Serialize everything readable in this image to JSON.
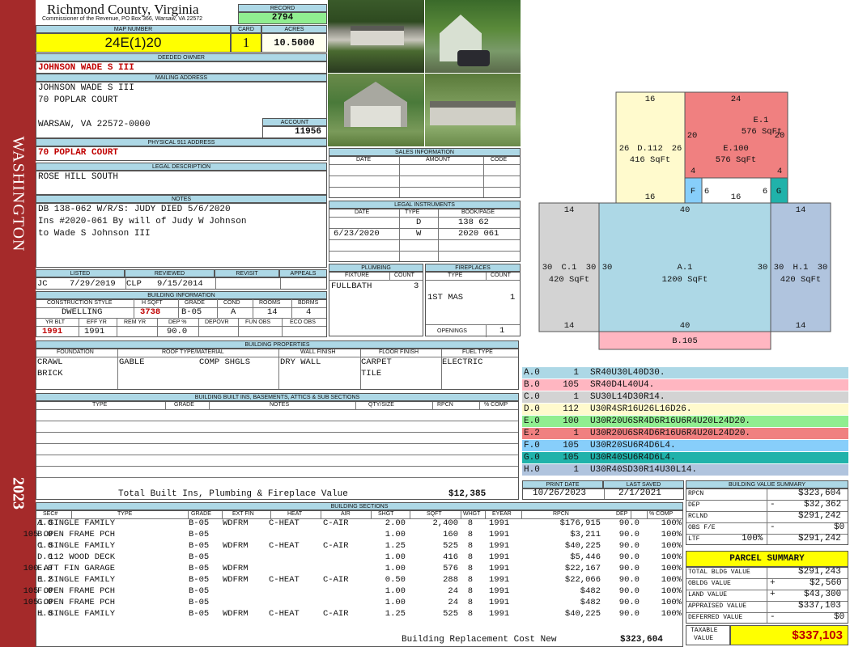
{
  "sidebar": {
    "district": "WASHINGTON",
    "year": "2023"
  },
  "header": {
    "county": "Richmond County, Virginia",
    "office": "Commissioner of the Revenue, PO Box 366, Warsaw, VA 22572"
  },
  "record": {
    "label": "RECORD",
    "value": "2794"
  },
  "map_number": {
    "label": "MAP NUMBER",
    "value": "24E(1)20"
  },
  "card": {
    "label": "CARD",
    "value": "1"
  },
  "acres": {
    "label": "ACRES",
    "value": "10.5000"
  },
  "deeded_owner": {
    "label": "DEEDED OWNER",
    "value": "JOHNSON WADE S III"
  },
  "mailing": {
    "label": "MAILING ADDRESS",
    "line1": "JOHNSON WADE S III",
    "line2": "70 POPLAR COURT",
    "line3": "WARSAW, VA 22572-0000"
  },
  "account": {
    "label": "ACCOUNT",
    "value": "11956"
  },
  "physical": {
    "label": "PHYSICAL 911 ADDRESS",
    "value": "70 POPLAR COURT"
  },
  "legal": {
    "label": "LEGAL DESCRIPTION",
    "value": "ROSE HILL SOUTH"
  },
  "notes": {
    "label": "NOTES",
    "line1": "DB 138-062 W/R/S: JUDY DIED 5/6/2020",
    "line2": "Ins #2020-061 By will of Judy W Johnson",
    "line3": "to Wade S Johnson III"
  },
  "sales": {
    "label": "SALES INFORMATION",
    "cols": [
      "DATE",
      "AMOUNT",
      "CODE"
    ]
  },
  "instruments": {
    "label": "LEGAL INSTRUMENTS",
    "cols": [
      "DATE",
      "TYPE",
      "BOOK/PAGE"
    ],
    "rows": [
      {
        "date": "",
        "type": "D",
        "bp": "138 62"
      },
      {
        "date": "6/23/2020",
        "type": "W",
        "bp": "2020 061"
      }
    ]
  },
  "listing": {
    "listed_label": "LISTED",
    "reviewed_label": "REVIEWED",
    "revisit_label": "REVISIT",
    "appeals_label": "APPEALS",
    "listed_by": "JC",
    "listed_date": "7/29/2019",
    "reviewed_by": "CLP",
    "reviewed_date": "9/15/2014"
  },
  "plumbing": {
    "label": "PLUMBING",
    "fixture_label": "FIXTURE",
    "count_label": "COUNT",
    "fixture": "FULLBATH",
    "count": "3"
  },
  "fireplaces": {
    "label": "FIREPLACES",
    "type_label": "TYPE",
    "count_label": "COUNT",
    "type": "1ST MAS",
    "count": "1",
    "openings_label": "OPENINGS",
    "openings": "1"
  },
  "building_info": {
    "label": "BUILDING INFORMATION",
    "h_cs": "CONSTRUCTION STYLE",
    "h_hsqft": "H SQFT",
    "h_grade": "GRADE",
    "h_cond": "COND",
    "h_rooms": "ROOMS",
    "h_bdrms": "BDRMS",
    "style": "DWELLING",
    "hsqft": "3738",
    "grade": "B-05",
    "cond": "A",
    "rooms": "14",
    "bdrms": "4",
    "h_yrblt": "YR BLT",
    "h_effyr": "EFF YR",
    "h_remyr": "REM YR",
    "h_dep": "DEP %",
    "h_depovr": "DEPOVR",
    "h_funobs": "FUN OBS",
    "h_ecoobs": "ECO OBS",
    "yrblt": "1991",
    "effyr": "1991",
    "dep": "90.0"
  },
  "properties": {
    "label": "BUILDING PROPERTIES",
    "h_found": "FOUNDATION",
    "h_roof": "ROOF TYPE/MATERIAL",
    "h_wall": "WALL FINISH",
    "h_floor": "FLOOR FINISH",
    "h_fuel": "FUEL TYPE",
    "found1": "CRAWL",
    "found2": "BRICK",
    "roof1": "GABLE",
    "roof2": "COMP SHGLS",
    "wall": "DRY WALL",
    "floor1": "CARPET",
    "floor2": "TILE",
    "fuel": "ELECTRIC"
  },
  "builtins": {
    "label": "BUILDING BUILT INS, BASEMENTS, ATTICS & SUB SECTIONS",
    "cols": [
      "TYPE",
      "GRADE",
      "NOTES",
      "QTY/SIZE",
      "RPCN",
      "% COMP"
    ],
    "total_label": "Total Built Ins, Plumbing & Fireplace Value",
    "total": "$12,385"
  },
  "print": {
    "print_label": "PRINT DATE",
    "saved_label": "LAST SAVED",
    "print_date": "10/26/2023",
    "saved_date": "2/1/2021"
  },
  "sections": {
    "label": "BUILDING SECTIONS",
    "cols": [
      "SEC#",
      "TYPE",
      "GRADE",
      "EXT FIN",
      "HEAT",
      "AIR",
      "SHGT",
      "SQFT",
      "WHGT",
      "EYEAR",
      "RPCN",
      "DEP",
      "% COMP"
    ],
    "rows": [
      {
        "sec": "A.0",
        "type": "1 SINGLE FAMILY",
        "grade": "B-05",
        "ext": "WDFRM",
        "heat": "C-HEAT",
        "air": "C-AIR",
        "shgt": "2.00",
        "sqft": "2,400",
        "whgt": "8",
        "eyear": "1991",
        "rpcn": "$176,915",
        "dep": "90.0",
        "comp": "100%"
      },
      {
        "sec": "B.0",
        "type": "105 OPEN FRAME PCH",
        "grade": "B-05",
        "ext": "",
        "heat": "",
        "air": "",
        "shgt": "1.00",
        "sqft": "160",
        "whgt": "8",
        "eyear": "1991",
        "rpcn": "$3,211",
        "dep": "90.0",
        "comp": "100%"
      },
      {
        "sec": "C.0",
        "type": "1 SINGLE FAMILY",
        "grade": "B-05",
        "ext": "WDFRM",
        "heat": "C-HEAT",
        "air": "C-AIR",
        "shgt": "1.25",
        "sqft": "525",
        "whgt": "8",
        "eyear": "1991",
        "rpcn": "$40,225",
        "dep": "90.0",
        "comp": "100%"
      },
      {
        "sec": "D.0",
        "type": "112 WOOD DECK",
        "grade": "B-05",
        "ext": "",
        "heat": "",
        "air": "",
        "shgt": "1.00",
        "sqft": "416",
        "whgt": "8",
        "eyear": "1991",
        "rpcn": "$5,446",
        "dep": "90.0",
        "comp": "100%"
      },
      {
        "sec": "E.0",
        "type": "100 ATT FIN GARAGE",
        "grade": "B-05",
        "ext": "WDFRM",
        "heat": "",
        "air": "",
        "shgt": "1.00",
        "sqft": "576",
        "whgt": "8",
        "eyear": "1991",
        "rpcn": "$22,167",
        "dep": "90.0",
        "comp": "100%"
      },
      {
        "sec": "E.2",
        "type": "1 SINGLE FAMILY",
        "grade": "B-05",
        "ext": "WDFRM",
        "heat": "C-HEAT",
        "air": "C-AIR",
        "shgt": "0.50",
        "sqft": "288",
        "whgt": "8",
        "eyear": "1991",
        "rpcn": "$22,066",
        "dep": "90.0",
        "comp": "100%"
      },
      {
        "sec": "F.0",
        "type": "105 OPEN FRAME PCH",
        "grade": "B-05",
        "ext": "",
        "heat": "",
        "air": "",
        "shgt": "1.00",
        "sqft": "24",
        "whgt": "8",
        "eyear": "1991",
        "rpcn": "$482",
        "dep": "90.0",
        "comp": "100%"
      },
      {
        "sec": "G.0",
        "type": "105 OPEN FRAME PCH",
        "grade": "B-05",
        "ext": "",
        "heat": "",
        "air": "",
        "shgt": "1.00",
        "sqft": "24",
        "whgt": "8",
        "eyear": "1991",
        "rpcn": "$482",
        "dep": "90.0",
        "comp": "100%"
      },
      {
        "sec": "H.0",
        "type": "1 SINGLE FAMILY",
        "grade": "B-05",
        "ext": "WDFRM",
        "heat": "C-HEAT",
        "air": "C-AIR",
        "shgt": "1.25",
        "sqft": "525",
        "whgt": "8",
        "eyear": "1991",
        "rpcn": "$40,225",
        "dep": "90.0",
        "comp": "100%"
      }
    ],
    "total_label": "Building Replacement Cost New",
    "total": "$323,604"
  },
  "segments": [
    {
      "id": "A.0",
      "code": "1",
      "desc": "SR40U30L40D30.",
      "color": "#add8e6"
    },
    {
      "id": "B.0",
      "code": "105",
      "desc": "SR40D4L40U4.",
      "color": "#ffb6c1"
    },
    {
      "id": "C.0",
      "code": "1",
      "desc": "SU30L14D30R14.",
      "color": "#d3d3d3"
    },
    {
      "id": "D.0",
      "code": "112",
      "desc": "U30R4SR16U26L16D26.",
      "color": "#fffacd"
    },
    {
      "id": "E.0",
      "code": "100",
      "desc": "U30R20U6SR4D6R16U6R4U20L24D20.",
      "color": "#90ee90"
    },
    {
      "id": "E.2",
      "code": "1",
      "desc": "U30R20U6SR4D6R16U6R4U20L24D20.",
      "color": "#f08080"
    },
    {
      "id": "F.0",
      "code": "105",
      "desc": "U30R20SU6R4D6L4.",
      "color": "#87cefa"
    },
    {
      "id": "G.0",
      "code": "105",
      "desc": "U30R40SU6R4D6L4.",
      "color": "#20b2aa"
    },
    {
      "id": "H.0",
      "code": "1",
      "desc": "U30R40SD30R14U30L14.",
      "color": "#b0c4de"
    }
  ],
  "sketch": {
    "d_top": "16",
    "d_left": "26",
    "d_right": "26",
    "d_label": "D.112",
    "d_area": "416 SqFt",
    "d_bottom": "16",
    "e_top": "24",
    "e_left": "20",
    "e_right": "20",
    "e_label1": "E.1",
    "e_area1": "576 SqFt",
    "e_label2": "E.100",
    "e_area2": "576 SqFt",
    "e_bottom": "16",
    "f_label": "F",
    "g_label": "G",
    "fg_left": "4",
    "fg_right": "4",
    "f_side": "6",
    "g_side": "6",
    "c_top": "14",
    "c_left": "30",
    "c_right": "30",
    "c_label": "C.1",
    "c_area": "420 SqFt",
    "c_bottom": "14",
    "a_top": "40",
    "a_left": "30",
    "a_right": "30",
    "a_label": "A.1",
    "a_area": "1200 SqFt",
    "a_bottom": "40",
    "h_top": "14",
    "h_left": "30",
    "h_right": "30",
    "h_label": "H.1",
    "h_area": "420 SqFt",
    "h_bottom": "14",
    "b_label": "B.105"
  },
  "value_summary": {
    "label": "BUILDING VALUE SUMMARY",
    "rpcn_label": "RPCN",
    "rpcn": "$323,604",
    "dep_label": "DEP",
    "dep_sign": "-",
    "dep": "$32,362",
    "rclnd_label": "RCLND",
    "rclnd": "$291,242",
    "obs_label": "OBS F/E",
    "obs_sign": "-",
    "obs": "$0",
    "ltf_label": "LTF",
    "ltf_pct": "100%",
    "ltf": "$291,242"
  },
  "parcel": {
    "label": "PARCEL SUMMARY",
    "tbv_label": "TOTAL BLDG VALUE",
    "tbv": "$291,243",
    "obldg_label": "OBLDG VALUE",
    "obldg_sign": "+",
    "obldg": "$2,560",
    "land_label": "LAND VALUE",
    "land_sign": "+",
    "land": "$43,300",
    "appraised_label": "APPRAISED VALUE",
    "appraised": "$337,103",
    "deferred_label": "DEFERRED VALUE",
    "deferred_sign": "-",
    "deferred": "$0",
    "taxable_label1": "TAXABLE",
    "taxable_label2": "VALUE",
    "taxable": "$337,103"
  }
}
